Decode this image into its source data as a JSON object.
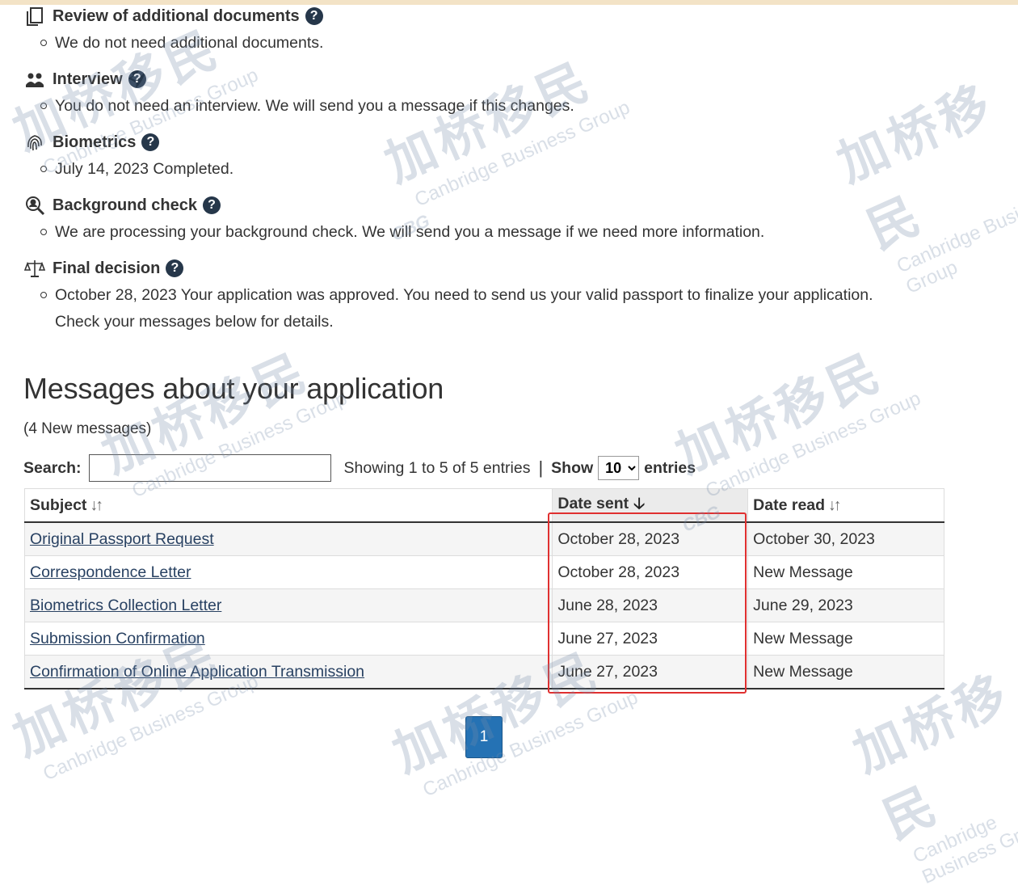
{
  "status_items": [
    {
      "title": "Review of additional documents",
      "icon": "documents-icon",
      "details": [
        "We do not need additional documents."
      ]
    },
    {
      "title": "Interview",
      "icon": "interview-icon",
      "details": [
        "You do not need an interview. We will send you a message if this changes."
      ]
    },
    {
      "title": "Biometrics",
      "icon": "fingerprint-icon",
      "details": [
        "July 14, 2023 Completed."
      ]
    },
    {
      "title": "Background check",
      "icon": "background-check-icon",
      "details": [
        "We are processing your background check. We will send you a message if we need more information."
      ]
    },
    {
      "title": "Final decision",
      "icon": "scales-icon",
      "details": [
        "October 28, 2023 Your application was approved. You need to send us your valid passport to finalize your application.",
        "Check your messages below for details."
      ]
    }
  ],
  "help_glyph": "?",
  "messages": {
    "title": "Messages about your application",
    "new_count": "(4 New messages)",
    "search_label": "Search:",
    "search_value": "",
    "showing": "Showing 1 to 5 of 5 entries",
    "separator": "|",
    "show_label": "Show",
    "page_size": "10",
    "entries_label": "entries",
    "columns": {
      "subject": "Subject",
      "date_sent": "Date sent",
      "date_read": "Date read"
    },
    "rows": [
      {
        "subject": "Original Passport Request",
        "date_sent": "October 28, 2023",
        "date_read": "October 30, 2023"
      },
      {
        "subject": "Correspondence Letter",
        "date_sent": "October 28, 2023",
        "date_read": "New Message"
      },
      {
        "subject": "Biometrics Collection Letter",
        "date_sent": "June 28, 2023",
        "date_read": "June 29, 2023"
      },
      {
        "subject": "Submission Confirmation",
        "date_sent": "June 27, 2023",
        "date_read": "New Message"
      },
      {
        "subject": "Confirmation of Online Application Transmission",
        "date_sent": "June 27, 2023",
        "date_read": "New Message"
      }
    ],
    "pagination": {
      "current": "1"
    }
  },
  "watermark": {
    "main": "加桥移民",
    "sub": "Canbridge Business Group",
    "logo": "CBG"
  },
  "colors": {
    "link": "#284162",
    "help": "#26374a",
    "pager": "#2572b4",
    "highlight": "#e03030"
  }
}
